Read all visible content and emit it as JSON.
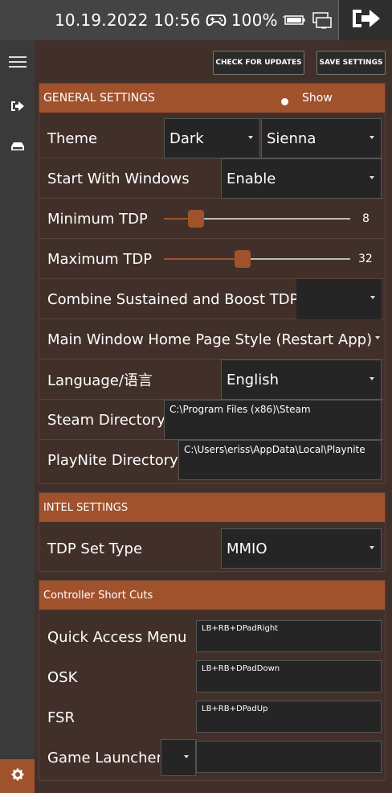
{
  "topbar": {
    "datetime": "10.19.2022 10:56",
    "battery": "100%",
    "icons": [
      "gamepad-icon",
      "battery-icon",
      "monitor-icon",
      "exit-icon"
    ]
  },
  "sidebar": {
    "icons": [
      "hamburger-menu-icon",
      "sign-out-icon",
      "hdd-icon",
      "gear-icon"
    ]
  },
  "header": {
    "check_updates": "CHECK FOR UPDATES",
    "save_settings": "SAVE SETTINGS"
  },
  "general": {
    "title": "GENERAL SETTINGS",
    "show_label": "Show",
    "show_on": true,
    "theme_label": "Theme",
    "theme_value": "Dark",
    "theme_color": "Sienna",
    "startwin_label": "Start With Windows",
    "startwin_value": "Enable",
    "min_tdp_label": "Minimum TDP",
    "min_tdp_value": "8",
    "min_tdp_frac": 0.13,
    "max_tdp_label": "Maximum TDP",
    "max_tdp_value": "32",
    "max_tdp_frac": 0.38,
    "combine_label": "Combine Sustained and Boost TDP",
    "combine_value": "",
    "homepage_label": "Main Window Home Page Style (Restart App)",
    "language_label": "Language/语言",
    "language_value": "English",
    "steam_label": "Steam Directory",
    "steam_value": "C:\\Program Files (x86)\\Steam",
    "playnite_label": "PlayNite Directory",
    "playnite_value": "C:\\Users\\eriss\\AppData\\Local\\Playnite"
  },
  "intel": {
    "title": "INTEL SETTINGS",
    "tdp_type_label": "TDP Set Type",
    "tdp_type_value": "MMIO"
  },
  "shortcuts": {
    "title": "Controller Short Cuts",
    "qam_label": "Quick Access Menu",
    "qam_value": "LB+RB+DPadRight",
    "osk_label": "OSK",
    "osk_value": "LB+RB+DPadDown",
    "fsr_label": "FSR",
    "fsr_value": "LB+RB+DPadUp",
    "launcher_label": "Game Launcher",
    "launcher_value": ""
  },
  "colors": {
    "accent": "#a0522d",
    "background": "#41302a",
    "sidebar": "#3a3a3a",
    "topbar": "#444444"
  }
}
